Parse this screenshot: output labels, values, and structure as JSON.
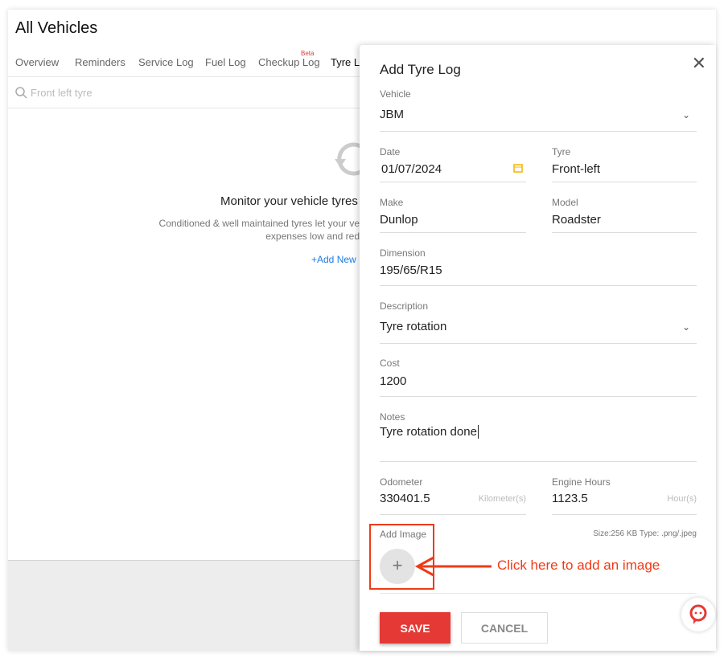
{
  "page": {
    "title": "All Vehicles"
  },
  "tabs": [
    {
      "label": "Overview"
    },
    {
      "label": "Reminders"
    },
    {
      "label": "Service Log"
    },
    {
      "label": "Fuel Log"
    },
    {
      "label": "Checkup Log",
      "badge": "Beta"
    },
    {
      "label": "Tyre Log",
      "active": true
    }
  ],
  "search": {
    "placeholder": "Front left tyre"
  },
  "empty_state": {
    "title": "Monitor your vehicle tyres",
    "line1": "Conditioned & well maintained tyres let your ve",
    "line2": "expenses low and red",
    "add_new": "+Add New"
  },
  "panel": {
    "title": "Add Tyre Log",
    "vehicle": {
      "label": "Vehicle",
      "value": "JBM"
    },
    "date": {
      "label": "Date",
      "value": "01/07/2024"
    },
    "tyre": {
      "label": "Tyre",
      "value": "Front-left"
    },
    "make": {
      "label": "Make",
      "value": "Dunlop"
    },
    "model": {
      "label": "Model",
      "value": "Roadster"
    },
    "dimension": {
      "label": "Dimension",
      "value": "195/65/R15"
    },
    "description": {
      "label": "Description",
      "value": "Tyre rotation"
    },
    "cost": {
      "label": "Cost",
      "value": "1200"
    },
    "notes": {
      "label": "Notes",
      "value": "Tyre rotation done"
    },
    "odometer": {
      "label": "Odometer",
      "value": "330401.5",
      "unit": "Kilometer(s)"
    },
    "engine_hours": {
      "label": "Engine Hours",
      "value": "1123.5",
      "unit": "Hour(s)"
    },
    "add_image": {
      "label": "Add Image",
      "info": "Size:256 KB Type: .png/.jpeg"
    },
    "save": "SAVE",
    "cancel": "CANCEL"
  },
  "annotation": {
    "text": "Click here to add an image",
    "color": "#f03a17"
  },
  "colors": {
    "accent": "#f5b400",
    "save": "#e53935",
    "link": "#1e7be0"
  }
}
